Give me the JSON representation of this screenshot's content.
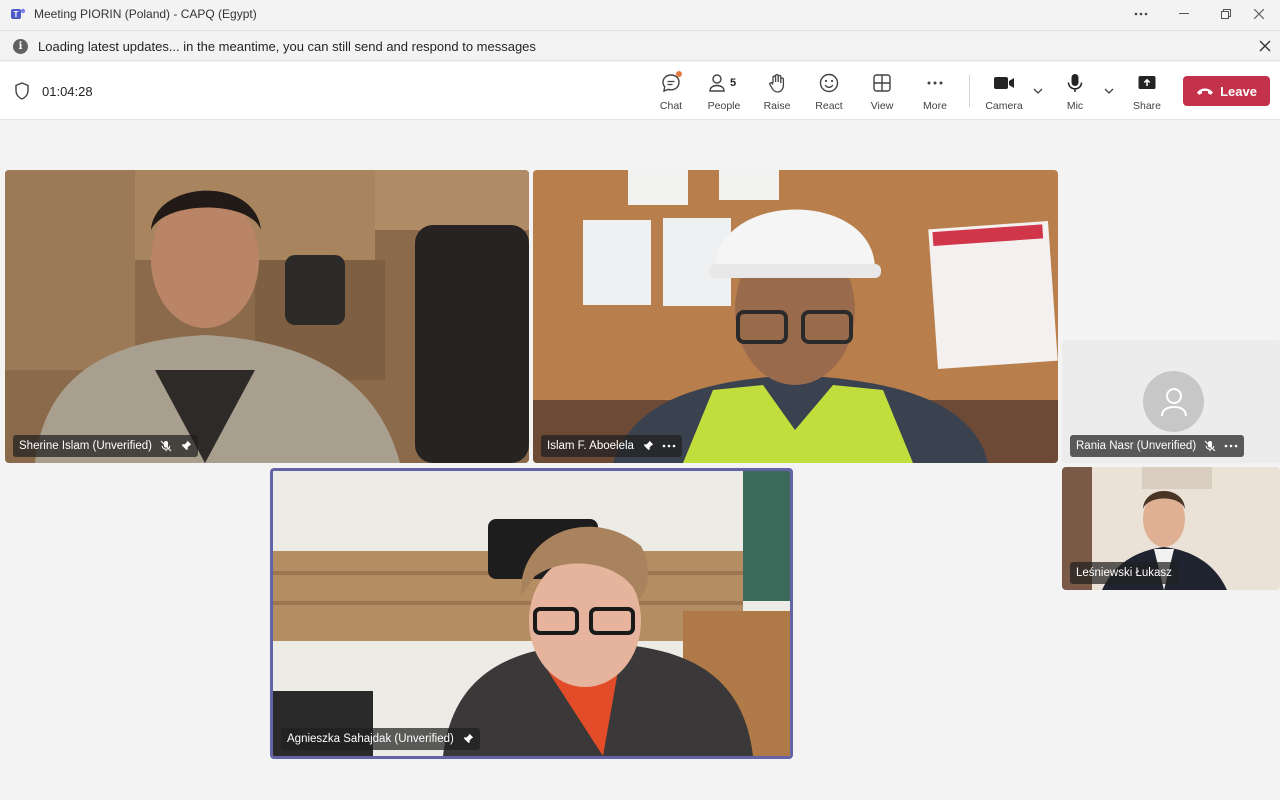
{
  "window": {
    "title": "Meeting PIORIN (Poland) - CAPQ (Egypt)",
    "controls": [
      "more-options",
      "minimize",
      "restore",
      "close"
    ]
  },
  "banner": {
    "text": "Loading latest updates... in the meantime, you can still send and respond to messages",
    "icon": "info-icon"
  },
  "toolbar": {
    "timer": "01:04:28",
    "chat_label": "Chat",
    "people_label": "People",
    "people_count": "5",
    "raise_label": "Raise",
    "react_label": "React",
    "view_label": "View",
    "more_label": "More",
    "camera_label": "Camera",
    "mic_label": "Mic",
    "share_label": "Share",
    "leave_label": "Leave"
  },
  "participants": [
    {
      "name": "Sherine Islam (Unverified)",
      "muted": true,
      "pinned": true
    },
    {
      "name": "Islam F. Aboelela",
      "muted": false,
      "pinned": true,
      "more": true
    },
    {
      "name": "Rania Nasr (Unverified)",
      "muted": true,
      "pinned": false,
      "more": true,
      "video": false
    },
    {
      "name": "Leśniewski Łukasz",
      "muted": false,
      "pinned": false
    },
    {
      "name": "Agnieszka Sahajdak (Unverified)",
      "muted": false,
      "pinned": true,
      "active_speaker": true
    }
  ],
  "colors": {
    "leave": "#c4314b",
    "active_border": "#6264a7",
    "chat_badge": "#e37d3f"
  }
}
